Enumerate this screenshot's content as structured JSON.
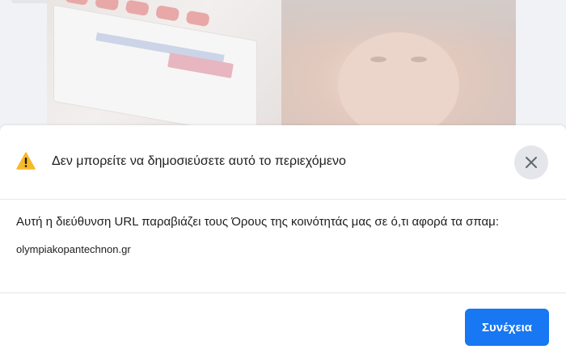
{
  "dialog": {
    "title": "Δεν μπορείτε να δημοσιεύσετε αυτό το περιεχόμενο",
    "message": "Αυτή η διεύθυνση URL παραβιάζει τους Όρους της κοινότητάς μας σε ό,τι αφορά τα σπαμ:",
    "url": "olympiakopantechnon.gr",
    "continue_label": "Συνέχεια",
    "icons": {
      "warning": "warning-triangle-icon",
      "close": "close-icon"
    },
    "colors": {
      "accent": "#1877f2",
      "warning": "#f7b928",
      "close_bg": "#e4e6eb"
    }
  }
}
